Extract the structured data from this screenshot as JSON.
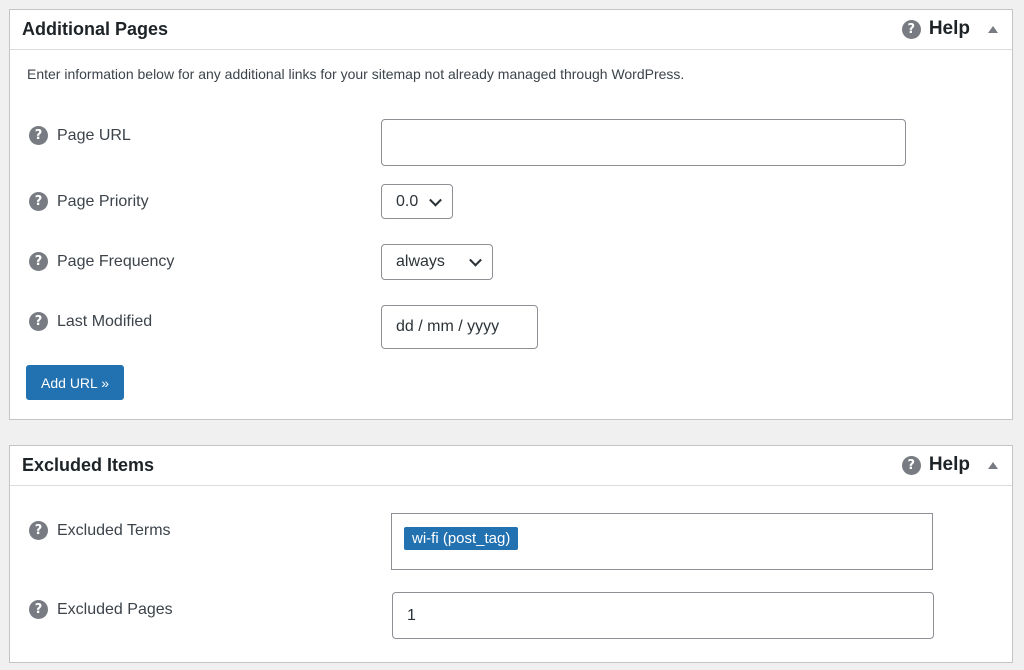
{
  "additional_pages": {
    "title": "Additional Pages",
    "help_label": "Help",
    "intro": "Enter information below for any additional links for your sitemap not already managed through WordPress.",
    "fields": {
      "page_url": {
        "label": "Page URL",
        "value": ""
      },
      "page_priority": {
        "label": "Page Priority",
        "value": "0.0"
      },
      "page_frequency": {
        "label": "Page Frequency",
        "value": "always"
      },
      "last_modified": {
        "label": "Last Modified",
        "placeholder": "dd / mm / yyyy"
      }
    },
    "add_button": "Add URL »"
  },
  "excluded_items": {
    "title": "Excluded Items",
    "help_label": "Help",
    "fields": {
      "excluded_terms": {
        "label": "Excluded Terms",
        "tags": [
          "wi-fi (post_tag)"
        ]
      },
      "excluded_pages": {
        "label": "Excluded Pages",
        "value": "1"
      }
    }
  },
  "icons": {
    "help": "question-circle-icon",
    "collapse": "triangle-up-icon",
    "dropdown": "chevron-down-icon"
  },
  "colors": {
    "accent": "#2271b1",
    "background": "#f0f0f1",
    "help_icon": "#787c82"
  }
}
